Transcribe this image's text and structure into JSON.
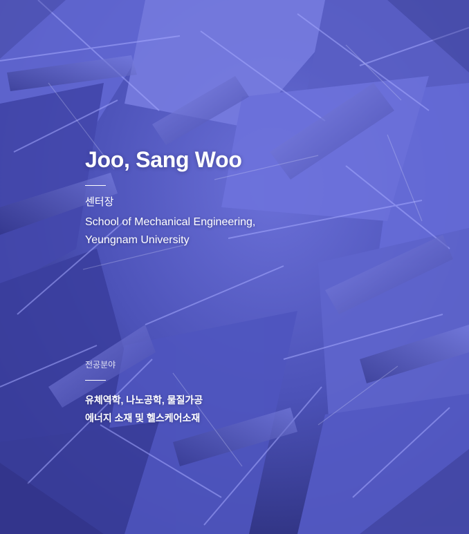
{
  "profile": {
    "name": "Joo, Sang Woo",
    "role": "센터장",
    "affiliation": [
      "School of Mechanical Engineering,",
      "Yeungnam University"
    ]
  },
  "fields": {
    "label": "전공분야",
    "items": [
      "유체역학, 나노공학, 물질가공",
      "에너지 소재 및 헬스케어소재"
    ]
  },
  "theme": {
    "background": "#4549a8",
    "text": "#ffffff"
  }
}
